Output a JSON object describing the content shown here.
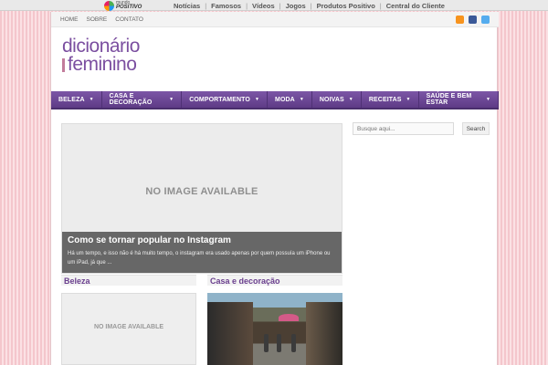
{
  "topbar": {
    "logo_small": "mundo",
    "logo_big": "POSITIVO",
    "links": [
      "Notícias",
      "Famosos",
      "Vídeos",
      "Jogos",
      "Produtos Positivo",
      "Central do Cliente"
    ]
  },
  "subnav": {
    "links": [
      "HOME",
      "SOBRE",
      "CONTATO"
    ],
    "social_icons": [
      "rss-icon",
      "facebook-icon",
      "twitter-icon"
    ]
  },
  "brand": {
    "line1": "dicionário",
    "line2": "feminino"
  },
  "mainnav": {
    "items": [
      "BELEZA",
      "CASA E DECORAÇÃO",
      "COMPORTAMENTO",
      "MODA",
      "NOIVAS",
      "RECEITAS",
      "SAÚDE E BEM ESTAR"
    ]
  },
  "feature": {
    "placeholder": "NO IMAGE AVAILABLE",
    "title": "Como se tornar popular no Instagram",
    "excerpt": "Há um tempo, e isso não é há muito tempo, o instagram era usado apenas por quem possuía um iPhone ou um iPad, já que ..."
  },
  "sections": [
    {
      "title": "Beleza",
      "placeholder": "NO IMAGE AVAILABLE"
    },
    {
      "title": "Casa e decoração"
    }
  ],
  "search": {
    "placeholder": "Busque aqui...",
    "button": "Search"
  },
  "colors": {
    "accent": "#6b4796",
    "background": "#f4c6cc"
  }
}
